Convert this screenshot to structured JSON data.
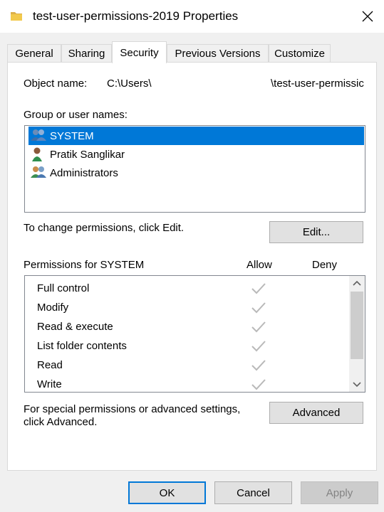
{
  "window": {
    "title": "test-user-permissions-2019 Properties",
    "icon": "folder-icon",
    "close_glyph": "✕"
  },
  "tabs": [
    {
      "label": "General",
      "active": false
    },
    {
      "label": "Sharing",
      "active": false
    },
    {
      "label": "Security",
      "active": true
    },
    {
      "label": "Previous Versions",
      "active": false
    },
    {
      "label": "Customize",
      "active": false
    }
  ],
  "security": {
    "object_name_label": "Object name:",
    "object_name_prefix": "C:\\Users\\",
    "object_name_suffix": "\\test-user-permissic",
    "group_label": "Group or user names:",
    "users": [
      {
        "name": "SYSTEM",
        "icon": "users-group-icon",
        "selected": true
      },
      {
        "name": "Pratik Sanglikar",
        "icon": "user-icon",
        "selected": false
      },
      {
        "name": "Administrators",
        "icon": "users-group-icon",
        "selected": false
      }
    ],
    "change_hint": "To change permissions, click Edit.",
    "edit_button": "Edit...",
    "permissions_label": "Permissions for SYSTEM",
    "allow_header": "Allow",
    "deny_header": "Deny",
    "permissions": [
      {
        "name": "Full control",
        "allow": true,
        "deny": false
      },
      {
        "name": "Modify",
        "allow": true,
        "deny": false
      },
      {
        "name": "Read & execute",
        "allow": true,
        "deny": false
      },
      {
        "name": "List folder contents",
        "allow": true,
        "deny": false
      },
      {
        "name": "Read",
        "allow": true,
        "deny": false
      },
      {
        "name": "Write",
        "allow": true,
        "deny": false
      }
    ],
    "advanced_hint_line1": "For special permissions or advanced settings,",
    "advanced_hint_line2": "click Advanced.",
    "advanced_button": "Advanced"
  },
  "footer": {
    "ok": "OK",
    "cancel": "Cancel",
    "apply": "Apply"
  },
  "colors": {
    "selection": "#0078d7",
    "check_disabled": "#b9b9b9"
  }
}
